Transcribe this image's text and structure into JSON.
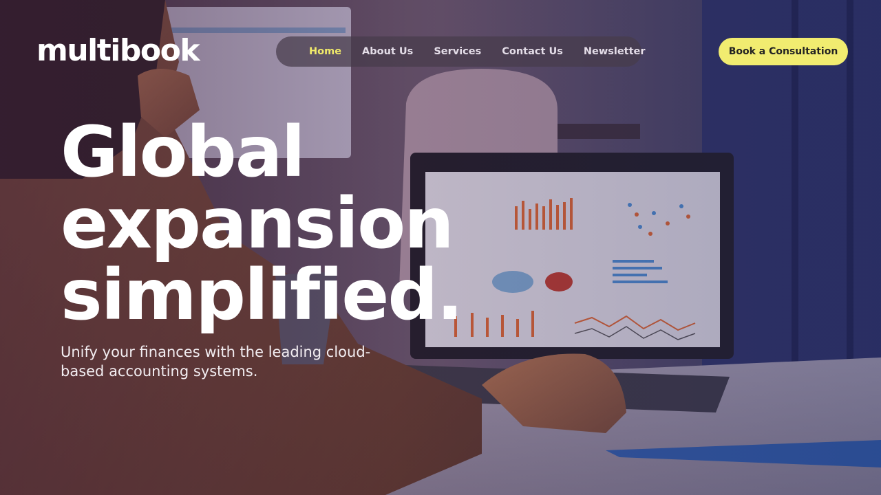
{
  "brand": {
    "logo_text": "multibook"
  },
  "nav": {
    "items": [
      {
        "label": "Home",
        "active": true
      },
      {
        "label": "About Us",
        "active": false
      },
      {
        "label": "Services",
        "active": false
      },
      {
        "label": "Contact Us",
        "active": false
      },
      {
        "label": "Newsletter",
        "active": false
      }
    ]
  },
  "cta": {
    "label": "Book a Consultation"
  },
  "hero": {
    "headline_lines": [
      "Global",
      "expansion",
      "simplified."
    ],
    "subheadline": "Unify your finances with the leading cloud-based accounting systems."
  },
  "colors": {
    "accent": "#f1ec70",
    "nav_active": "#f0ea6a",
    "text": "#ffffff"
  }
}
